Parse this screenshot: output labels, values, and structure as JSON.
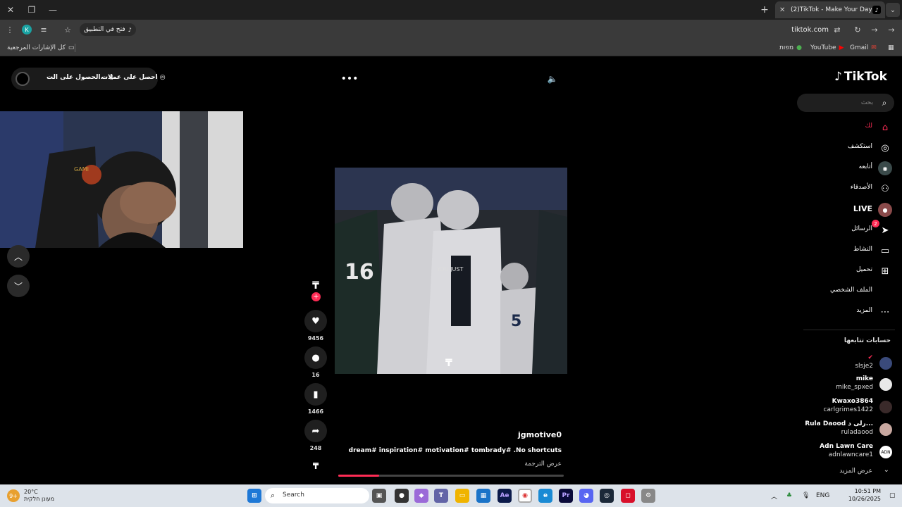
{
  "browser": {
    "tab_title": "(2)TikTok - Make Your Day",
    "new_tab_symbol": "+",
    "profile_initial": "K",
    "open_in_app": "فتح في التطبيق",
    "url": "tiktok.com",
    "bookmarks": {
      "all_bookmarks": "كل الإشارات المرجعية",
      "gmail": "Gmail",
      "youtube": "YouTube",
      "maps": "מפות"
    }
  },
  "tiktok": {
    "logo_text": "TikTok",
    "search_placeholder": "بحث",
    "top_links": {
      "get_coins": "احصل على عملات",
      "get_app": "الحصول على الت..."
    },
    "nav": [
      {
        "label": "لك",
        "icon": "home-icon",
        "active": true
      },
      {
        "label": "استكشف",
        "icon": "compass-icon"
      },
      {
        "label": "أتابعه",
        "icon": "following-avatar-icon"
      },
      {
        "label": "الأصدقاء",
        "icon": "friends-icon"
      },
      {
        "label": "LIVE",
        "icon": "live-avatar-icon"
      },
      {
        "label": "الرسائل",
        "icon": "send-icon",
        "badge": "2"
      },
      {
        "label": "النشاط",
        "icon": "activity-icon"
      },
      {
        "label": "تحميل",
        "icon": "upload-icon"
      },
      {
        "label": "الملف الشخصي",
        "icon": "profile-icon"
      },
      {
        "label": "المزيد",
        "icon": "more-icon"
      }
    ],
    "following_title": "حسابات تتابعها",
    "following_accounts": [
      {
        "name": "✔",
        "handle": "slsje2"
      },
      {
        "name": "mike",
        "handle": "mike_spxed"
      },
      {
        "name": "Kwaxo3864",
        "handle": "carlgrimes1422"
      },
      {
        "name": "Rula Daood رلى د...",
        "handle": "ruladaood"
      },
      {
        "name": "Adn Lawn Care",
        "handle": "adnlawncare1",
        "avatar_text": "ADN"
      }
    ],
    "show_more": "عرض المزيد",
    "video": {
      "watermark": "YOU JUST",
      "username": "jgmotive0",
      "caption": "dream# inspiration# motivation# tombrady# .No shortcuts",
      "see_translation": "عرض الترجمة",
      "progress_fraction": 0.18
    },
    "actions": {
      "likes": "9456",
      "comments": "16",
      "saves": "1466",
      "shares": "248"
    }
  },
  "taskbar": {
    "weather_badge": "9+",
    "temperature": "20°C",
    "weather_desc": "מעונן חלקית",
    "search_label": "Search",
    "language": "ENG",
    "time": "10:51 PM",
    "date": "10/26/2025"
  },
  "colors": {
    "accent": "#fe2c55",
    "page_bg": "#000000",
    "chrome_bg": "#3a3a3a",
    "taskbar_bg": "#dde3ea"
  }
}
